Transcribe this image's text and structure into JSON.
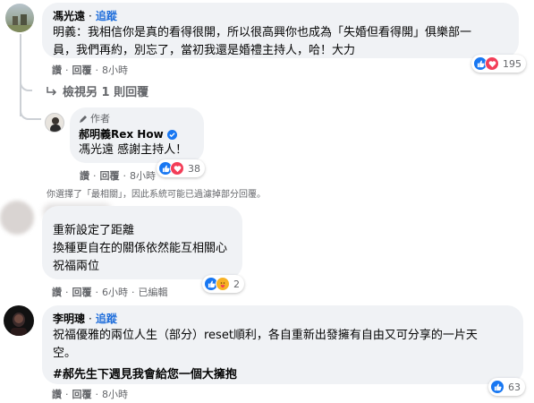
{
  "comments": [
    {
      "author": "馮光遠",
      "follow": "追蹤",
      "lines": [
        "明義：我相信你是真的看得很開，所以很高興你也成為「失婚但看得開」俱樂部一",
        "員，我們再約，別忘了，當初我還是婚禮主持人，哈！大力"
      ],
      "actions": {
        "like": "讚",
        "reply": "回覆",
        "time": "8小時"
      },
      "reactions": {
        "count": "195"
      }
    },
    {
      "author": "",
      "lines": [
        "重新設定了距離",
        "換種更自在的關係依然能互相關心",
        "祝福兩位"
      ],
      "actions": {
        "like": "讚",
        "reply": "回覆",
        "time": "6小時",
        "edited": "已編輯"
      },
      "reactions": {
        "count": "2"
      }
    },
    {
      "author": "李明璁",
      "follow": "追蹤",
      "lines": [
        "祝福優雅的兩位人生（部分）reset順利，各自重新出發擁有自由又可分享的一片天",
        "空。"
      ],
      "hashtag": "#郝先生下週見我會給您一個大擁抱",
      "actions": {
        "like": "讚",
        "reply": "回覆",
        "time": "8小時"
      },
      "reactions": {
        "count": "63"
      }
    }
  ],
  "view_replies": "檢視另 1 則回覆",
  "reply": {
    "author_badge": "作者",
    "author": "郝明義Rex How",
    "text": "馮光遠 感謝主持人！",
    "actions": {
      "like": "讚",
      "reply": "回覆",
      "time": "8小時"
    },
    "reactions": {
      "count": "38"
    }
  },
  "filter_notice": "你選擇了「最相關」，因此系統可能已過濾掉部分回覆。",
  "colors": {
    "like": "#1877f2",
    "love": "#f33e58",
    "haha": "#f7b125",
    "link": "#216fdb",
    "bubble": "#f0f2f5"
  }
}
